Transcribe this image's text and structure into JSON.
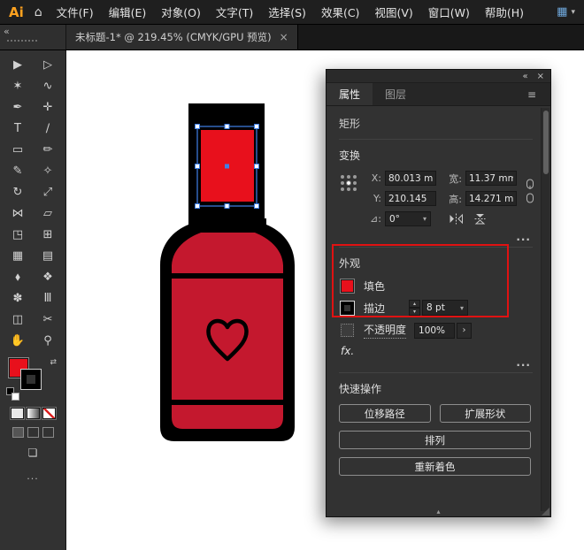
{
  "colors": {
    "accent_red": "#e8101c",
    "body_red": "#c4182e",
    "selection_blue": "#3f80e8",
    "annotation_red": "#e01212"
  },
  "icons": {
    "caret": "▾",
    "up": "▴",
    "down": "▾",
    "chevron_right": "›",
    "scroll_up": "▴"
  },
  "menubar": {
    "logo": "Ai",
    "home_icon": "⌂",
    "items": [
      "文件(F)",
      "编辑(E)",
      "对象(O)",
      "文字(T)",
      "选择(S)",
      "效果(C)",
      "视图(V)",
      "窗口(W)",
      "帮助(H)"
    ],
    "workspace_icon": "▦",
    "workspace_caret": "▾"
  },
  "tabbar": {
    "title": "未标题-1* @ 219.45% (CMYK/GPU 预览)",
    "close": "×"
  },
  "toolbar": {
    "collapse_icon": "«",
    "swap_icon": "⇄",
    "screen_mode_icon": "❏",
    "more_icon": "...",
    "tools": [
      {
        "name": "selection",
        "glyph": "▶"
      },
      {
        "name": "direct-selection",
        "glyph": "▷"
      },
      {
        "name": "magic-wand",
        "glyph": "✶"
      },
      {
        "name": "lasso",
        "glyph": "∿"
      },
      {
        "name": "pen",
        "glyph": "✒"
      },
      {
        "name": "add-anchor",
        "glyph": "✛"
      },
      {
        "name": "type",
        "glyph": "T"
      },
      {
        "name": "line-segment",
        "glyph": "∕"
      },
      {
        "name": "rectangle",
        "glyph": "▭"
      },
      {
        "name": "paintbrush",
        "glyph": "✏"
      },
      {
        "name": "pencil",
        "glyph": "✎"
      },
      {
        "name": "shaper",
        "glyph": "✧"
      },
      {
        "name": "rotate",
        "glyph": "↻"
      },
      {
        "name": "scale",
        "glyph": "⤢"
      },
      {
        "name": "width",
        "glyph": "⋈"
      },
      {
        "name": "free-transform",
        "glyph": "▱"
      },
      {
        "name": "shape-builder",
        "glyph": "◳"
      },
      {
        "name": "perspective-grid",
        "glyph": "⊞"
      },
      {
        "name": "mesh",
        "glyph": "▦"
      },
      {
        "name": "gradient",
        "glyph": "▤"
      },
      {
        "name": "eyedropper",
        "glyph": "⬧"
      },
      {
        "name": "blend",
        "glyph": "❖"
      },
      {
        "name": "symbol-sprayer",
        "glyph": "✽"
      },
      {
        "name": "column-graph",
        "glyph": "Ⅲ"
      },
      {
        "name": "artboard",
        "glyph": "◫"
      },
      {
        "name": "slice",
        "glyph": "✂"
      },
      {
        "name": "hand",
        "glyph": "✋"
      },
      {
        "name": "zoom",
        "glyph": "⚲"
      }
    ]
  },
  "panel": {
    "collapse_icon": "«",
    "close_icon": "×",
    "menu_icon": "≡",
    "tabs": [
      {
        "label": "属性"
      },
      {
        "label": "图层"
      }
    ],
    "object_type": "矩形",
    "transform": {
      "title": "变换",
      "fields": [
        {
          "label": "X:",
          "value": "80.013 m"
        },
        {
          "label": "宽:",
          "value": "11.37 mm"
        },
        {
          "label": "Y:",
          "value": "210.145"
        },
        {
          "label": "高:",
          "value": "14.271 m"
        }
      ],
      "angle_label": "⊿:",
      "angle_value": "0°",
      "more": "..."
    },
    "appearance": {
      "title": "外观",
      "fill_label": "填色",
      "stroke_label": "描边",
      "stroke_weight": "8 pt",
      "opacity_label": "不透明度",
      "opacity_value": "100%",
      "fx_label": "fx.",
      "more": "..."
    },
    "quick_actions": {
      "title": "快速操作",
      "buttons": [
        "位移路径",
        "扩展形状",
        "排列",
        "重新着色"
      ]
    }
  }
}
